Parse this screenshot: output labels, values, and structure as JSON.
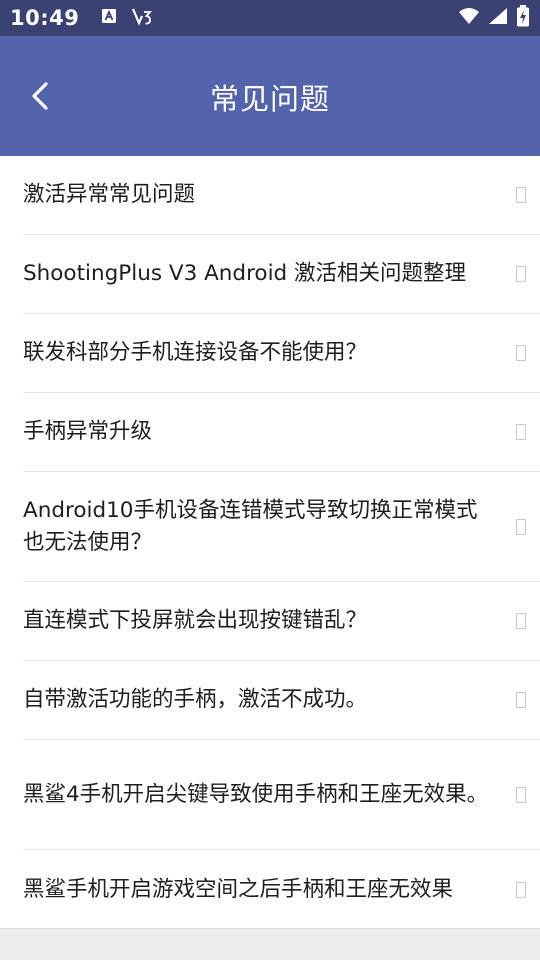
{
  "status_bar": {
    "time": "10:49",
    "icons": [
      "font-a-icon",
      "signal-3-icon",
      "wifi-icon",
      "cellular-icon",
      "battery-charging-icon"
    ]
  },
  "app_bar": {
    "title": "常见问题",
    "back_icon": "chevron-left-icon"
  },
  "faq": {
    "items": [
      {
        "label": "激活异常常见问题"
      },
      {
        "label": "ShootingPlus V3 Android 激活相关问题整理"
      },
      {
        "label": "联发科部分手机连接设备不能使用？"
      },
      {
        "label": "手柄异常升级"
      },
      {
        "label": "Android10手机设备连错模式导致切换正常模式也无法使用？"
      },
      {
        "label": "直连模式下投屏就会出现按键错乱？"
      },
      {
        "label": "自带激活功能的手柄，激活不成功。"
      },
      {
        "label": "黑鲨4手机开启尖键导致使用手柄和王座无效果。"
      },
      {
        "label": "黑鲨手机开启游戏空间之后手柄和王座无效果"
      }
    ]
  },
  "colors": {
    "status_bar": "#3a4273",
    "app_bar": "#5363ac",
    "list_bg": "#ffffff",
    "page_bg": "#eeeef2"
  }
}
